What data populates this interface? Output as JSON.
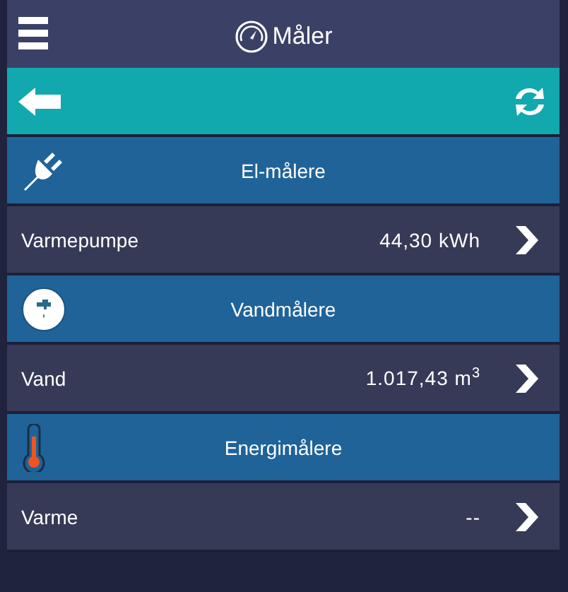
{
  "header": {
    "title": "Måler"
  },
  "groups": [
    {
      "kind": "electricity",
      "title": "El-målere",
      "rows": [
        {
          "name": "Varmepumpe",
          "value": "44,30 kWh"
        }
      ]
    },
    {
      "kind": "water",
      "title": "Vandmålere",
      "rows": [
        {
          "name": "Vand",
          "value": "1.017,43 m$^{3}$"
        }
      ]
    },
    {
      "kind": "energy",
      "title": "Energimålere",
      "rows": [
        {
          "name": "Varme",
          "value": "--"
        }
      ]
    }
  ]
}
